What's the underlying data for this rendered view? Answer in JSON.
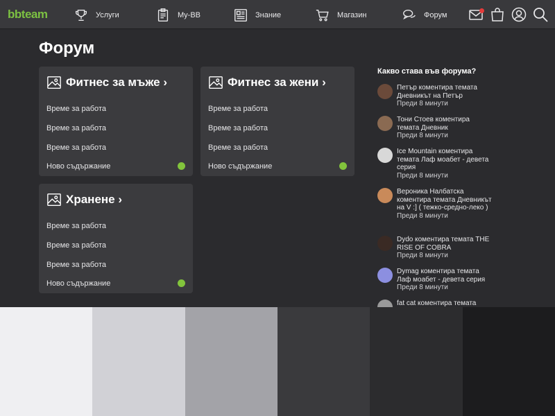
{
  "logo": {
    "bb": "bb",
    "team": "team"
  },
  "nav": [
    {
      "label": "Услуги",
      "icon": "trophy-icon"
    },
    {
      "label": "My-BB",
      "icon": "clipboard-icon"
    },
    {
      "label": "Знание",
      "icon": "newspaper-icon"
    },
    {
      "label": "Магазин",
      "icon": "cart-icon"
    },
    {
      "label": "Форум",
      "icon": "chat-icon"
    }
  ],
  "page_title": "Форум",
  "cards": [
    {
      "title": "Фитнес за мъже ›",
      "rows": [
        "Време за работа",
        "Време за работа",
        "Време за работа",
        "Ново съдържание"
      ]
    },
    {
      "title": "Фитнес за жени ›",
      "rows": [
        "Време за работа",
        "Време за работа",
        "Време за работа",
        "Ново съдържание"
      ]
    },
    {
      "title": "Хранене ›",
      "rows": [
        "Време за работа",
        "Време за работа",
        "Време за работа",
        "Ново съдържание"
      ]
    }
  ],
  "activity": {
    "title": "Какво става във форума?",
    "items": [
      {
        "text": "Петър коментира темата Дневникът на Петър",
        "time": "Преди 8 минути",
        "avatar_color": "#6b4a3a"
      },
      {
        "text": "Тони Стоев коментира темата Дневник",
        "time": "Преди 8 минути",
        "avatar_color": "#8a6a52"
      },
      {
        "text": "Ice Mountain коментира темата Лаф моабет - девета серия",
        "time": "Преди 8 минути",
        "avatar_color": "#d8d8d8"
      },
      {
        "text": "Вероника Налбатска коментира темата Дневникът на V :] ( тежко-средно-леко )",
        "time": "Преди 8 минути",
        "avatar_color": "#c98a5a"
      },
      {
        "text": "Dydo коментира темата THE RISE OF COBRA",
        "time": "Преди 8 минути",
        "avatar_color": "#3a2a24"
      },
      {
        "text": "Dymag коментира темата Лаф моабет - девета серия",
        "time": "Преди 8 минути",
        "avatar_color": "#8c8fe0"
      },
      {
        "text": "fat cat коментира темата",
        "time": "",
        "avatar_color": "#9a9a9a"
      }
    ]
  },
  "colors": {
    "accent": "#7cc142",
    "dot": "#82c43c",
    "swatches": [
      "#efeff2",
      "#d1d1d6",
      "#a3a3a8",
      "#3a3a3d",
      "#2c2c2e",
      "#1c1c1e"
    ]
  }
}
